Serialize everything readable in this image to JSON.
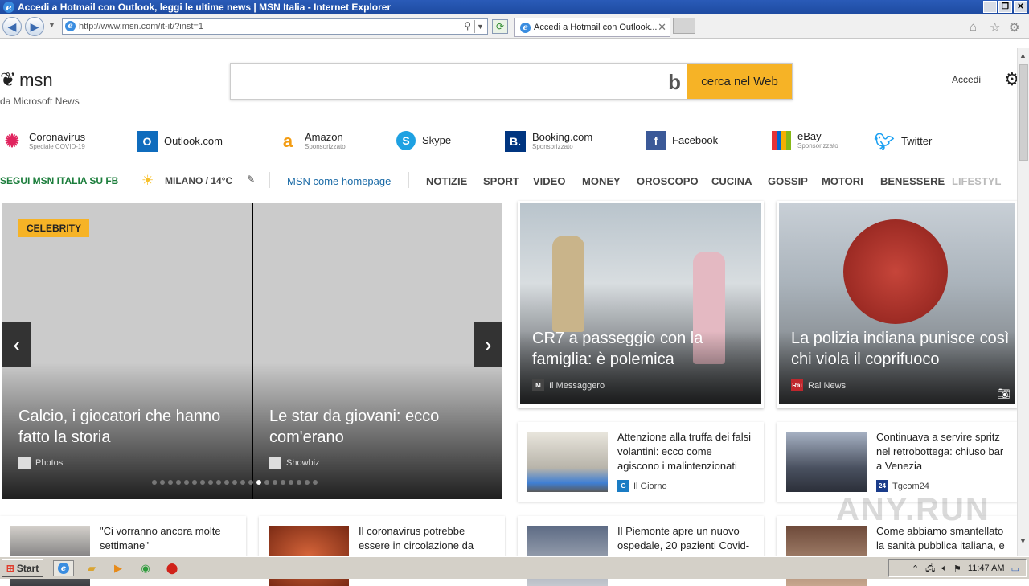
{
  "window": {
    "title": "Accedi a Hotmail con Outlook, leggi le ultime news | MSN Italia - Internet Explorer"
  },
  "browser": {
    "url": "http://www.msn.com/it-it/?inst=1",
    "tab_label": "Accedi a Hotmail con Outlook...",
    "back_icon": "back-icon",
    "forward_icon": "forward-icon"
  },
  "header": {
    "logo": "msn",
    "logo_sub": "da Microsoft News",
    "search_placeholder": "",
    "search_button": "cerca nel Web",
    "signin": "Accedi"
  },
  "quicklinks": [
    {
      "label": "Coronavirus",
      "sub": "Speciale COVID-19",
      "icon": "virus-icon",
      "color": "#e0245e"
    },
    {
      "label": "Outlook.com",
      "sub": "",
      "icon": "outlook-icon",
      "color": "#0f6cbd"
    },
    {
      "label": "Amazon",
      "sub": "Sponsorizzato",
      "icon": "amazon-icon",
      "color": "#f39c12"
    },
    {
      "label": "Skype",
      "sub": "",
      "icon": "skype-icon",
      "color": "#1ea1e2"
    },
    {
      "label": "Booking.com",
      "sub": "Sponsorizzato",
      "icon": "booking-icon",
      "color": "#003580"
    },
    {
      "label": "Facebook",
      "sub": "",
      "icon": "facebook-icon",
      "color": "#3b5998"
    },
    {
      "label": "eBay",
      "sub": "Sponsorizzato",
      "icon": "ebay-icon",
      "color": "#e53238"
    },
    {
      "label": "Twitter",
      "sub": "",
      "icon": "twitter-icon",
      "color": "#1da1f2"
    }
  ],
  "navbar": {
    "follow": "SEGUI MSN ITALIA SU FB",
    "weather": "MILANO / 14°C",
    "homepage": "MSN come homepage",
    "items": [
      "NOTIZIE",
      "SPORT",
      "VIDEO",
      "MONEY",
      "OROSCOPO",
      "CUCINA",
      "GOSSIP",
      "MOTORI",
      "BENESSERE",
      "LIFESTYL"
    ]
  },
  "carousel": {
    "tag": "CELEBRITY",
    "slides": [
      {
        "caption": "Calcio, i giocatori che hanno fatto la storia",
        "source": "Photos"
      },
      {
        "caption": "Le star da giovani: ecco com'erano",
        "source": "Showbiz"
      }
    ],
    "dot_count": 21,
    "active_dot": 13
  },
  "bigcards": [
    {
      "caption": "CR7 a passeggio con la famiglia: è polemica",
      "source": "Il Messaggero",
      "badge": "M"
    },
    {
      "caption": "La polizia indiana punisce così chi viola il coprifuoco",
      "source": "Rai News",
      "badge": "Rai"
    }
  ],
  "cards": [
    {
      "title": "Attenzione alla truffa dei falsi volantini: ecco come agiscono i malintenzionati",
      "source": "Il Giorno",
      "badge": "G"
    },
    {
      "title": "Continuava a servire spritz nel retrobottega: chiuso bar a Venezia",
      "source": "Tgcom24",
      "badge": "24"
    },
    {
      "title": "\"Ci vorranno ancora molte settimane\"",
      "source": ""
    },
    {
      "title": "Il coronavirus potrebbe essere in circolazione da",
      "source": ""
    },
    {
      "title": "Il Piemonte apre un nuovo ospedale, 20 pazienti Covid-",
      "source": ""
    },
    {
      "title": "Come abbiamo smantellato la sanità pubblica italiana, e",
      "source": ""
    }
  ],
  "taskbar": {
    "start": "Start",
    "clock": "11:47 AM"
  },
  "watermark": "ANY.RUN"
}
